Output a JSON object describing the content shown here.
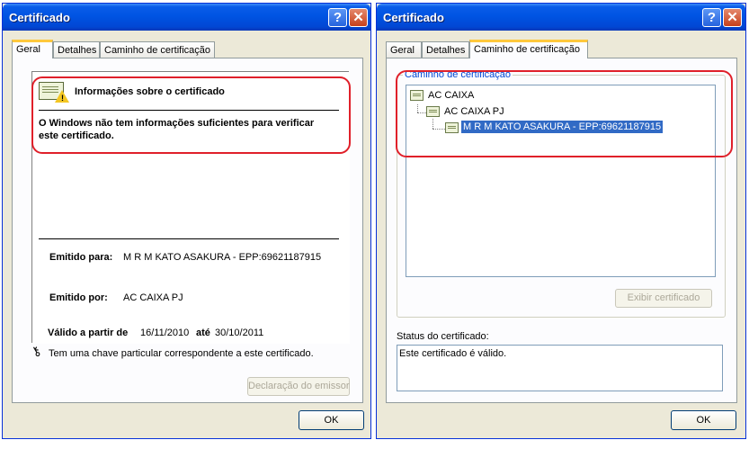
{
  "window_left": {
    "title": "Certificado",
    "tabs": [
      "Geral",
      "Detalhes",
      "Caminho de certificação"
    ],
    "info_heading": "Informações sobre o certificado",
    "info_message_line1": "O Windows não tem informações suficientes para verificar",
    "info_message_line2": "este certificado.",
    "issued_to_label": "Emitido para:",
    "issued_to_value": "M R M KATO ASAKURA - EPP:69621187915",
    "issued_by_label": "Emitido por:",
    "issued_by_value": "AC CAIXA PJ",
    "valid_from_label": "Válido a partir de",
    "valid_from_value": "16/11/2010",
    "valid_to_label": "até",
    "valid_to_value": "30/10/2011",
    "private_key_note": "Tem uma chave particular correspondente a este certificado.",
    "issuer_statement_button": "Declaração do emissor",
    "ok_button": "OK"
  },
  "window_right": {
    "title": "Certificado",
    "tabs": [
      "Geral",
      "Detalhes",
      "Caminho de certificação"
    ],
    "path_group_label": "Caminho de certificação",
    "tree": [
      "AC CAIXA",
      "AC CAIXA PJ",
      "M R M KATO ASAKURA - EPP:69621187915"
    ],
    "view_certificate_button": "Exibir certificado",
    "status_label": "Status do certificado:",
    "status_value": "Este certificado é válido.",
    "ok_button": "OK"
  },
  "colors": {
    "titlebar": "#0054e3",
    "window_bg": "#ece9d8",
    "highlight_outline": "#e0202a",
    "selection": "#316ac5",
    "group_label": "#0046d5"
  },
  "icons": {
    "help": "question-mark",
    "close": "x-mark",
    "certificate_warning": "certificate-warning-icon",
    "certificate": "certificate-icon",
    "key": "key-icon"
  }
}
